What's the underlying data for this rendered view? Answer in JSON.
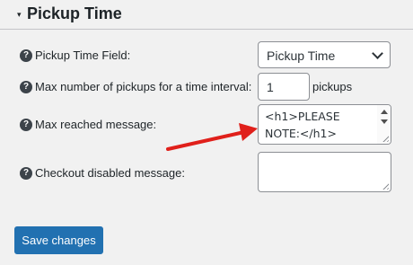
{
  "section": {
    "title": "Pickup Time",
    "caret": "▾"
  },
  "fields": {
    "pickup_time_field": {
      "help": "?",
      "label": "Pickup Time Field:",
      "value": "Pickup Time"
    },
    "max_pickups": {
      "help": "?",
      "label": "Max number of pickups for a time interval:",
      "value": "1",
      "unit": "pickups"
    },
    "max_reached_message": {
      "help": "?",
      "label": "Max reached message:",
      "value": "<h1>PLEASE NOTE:</h1>"
    },
    "checkout_disabled_message": {
      "help": "?",
      "label": "Checkout disabled message:",
      "value": ""
    }
  },
  "buttons": {
    "save": "Save changes"
  },
  "colors": {
    "primary": "#2271b1",
    "annotation": "#e0201b",
    "background": "#f1f1f1"
  }
}
